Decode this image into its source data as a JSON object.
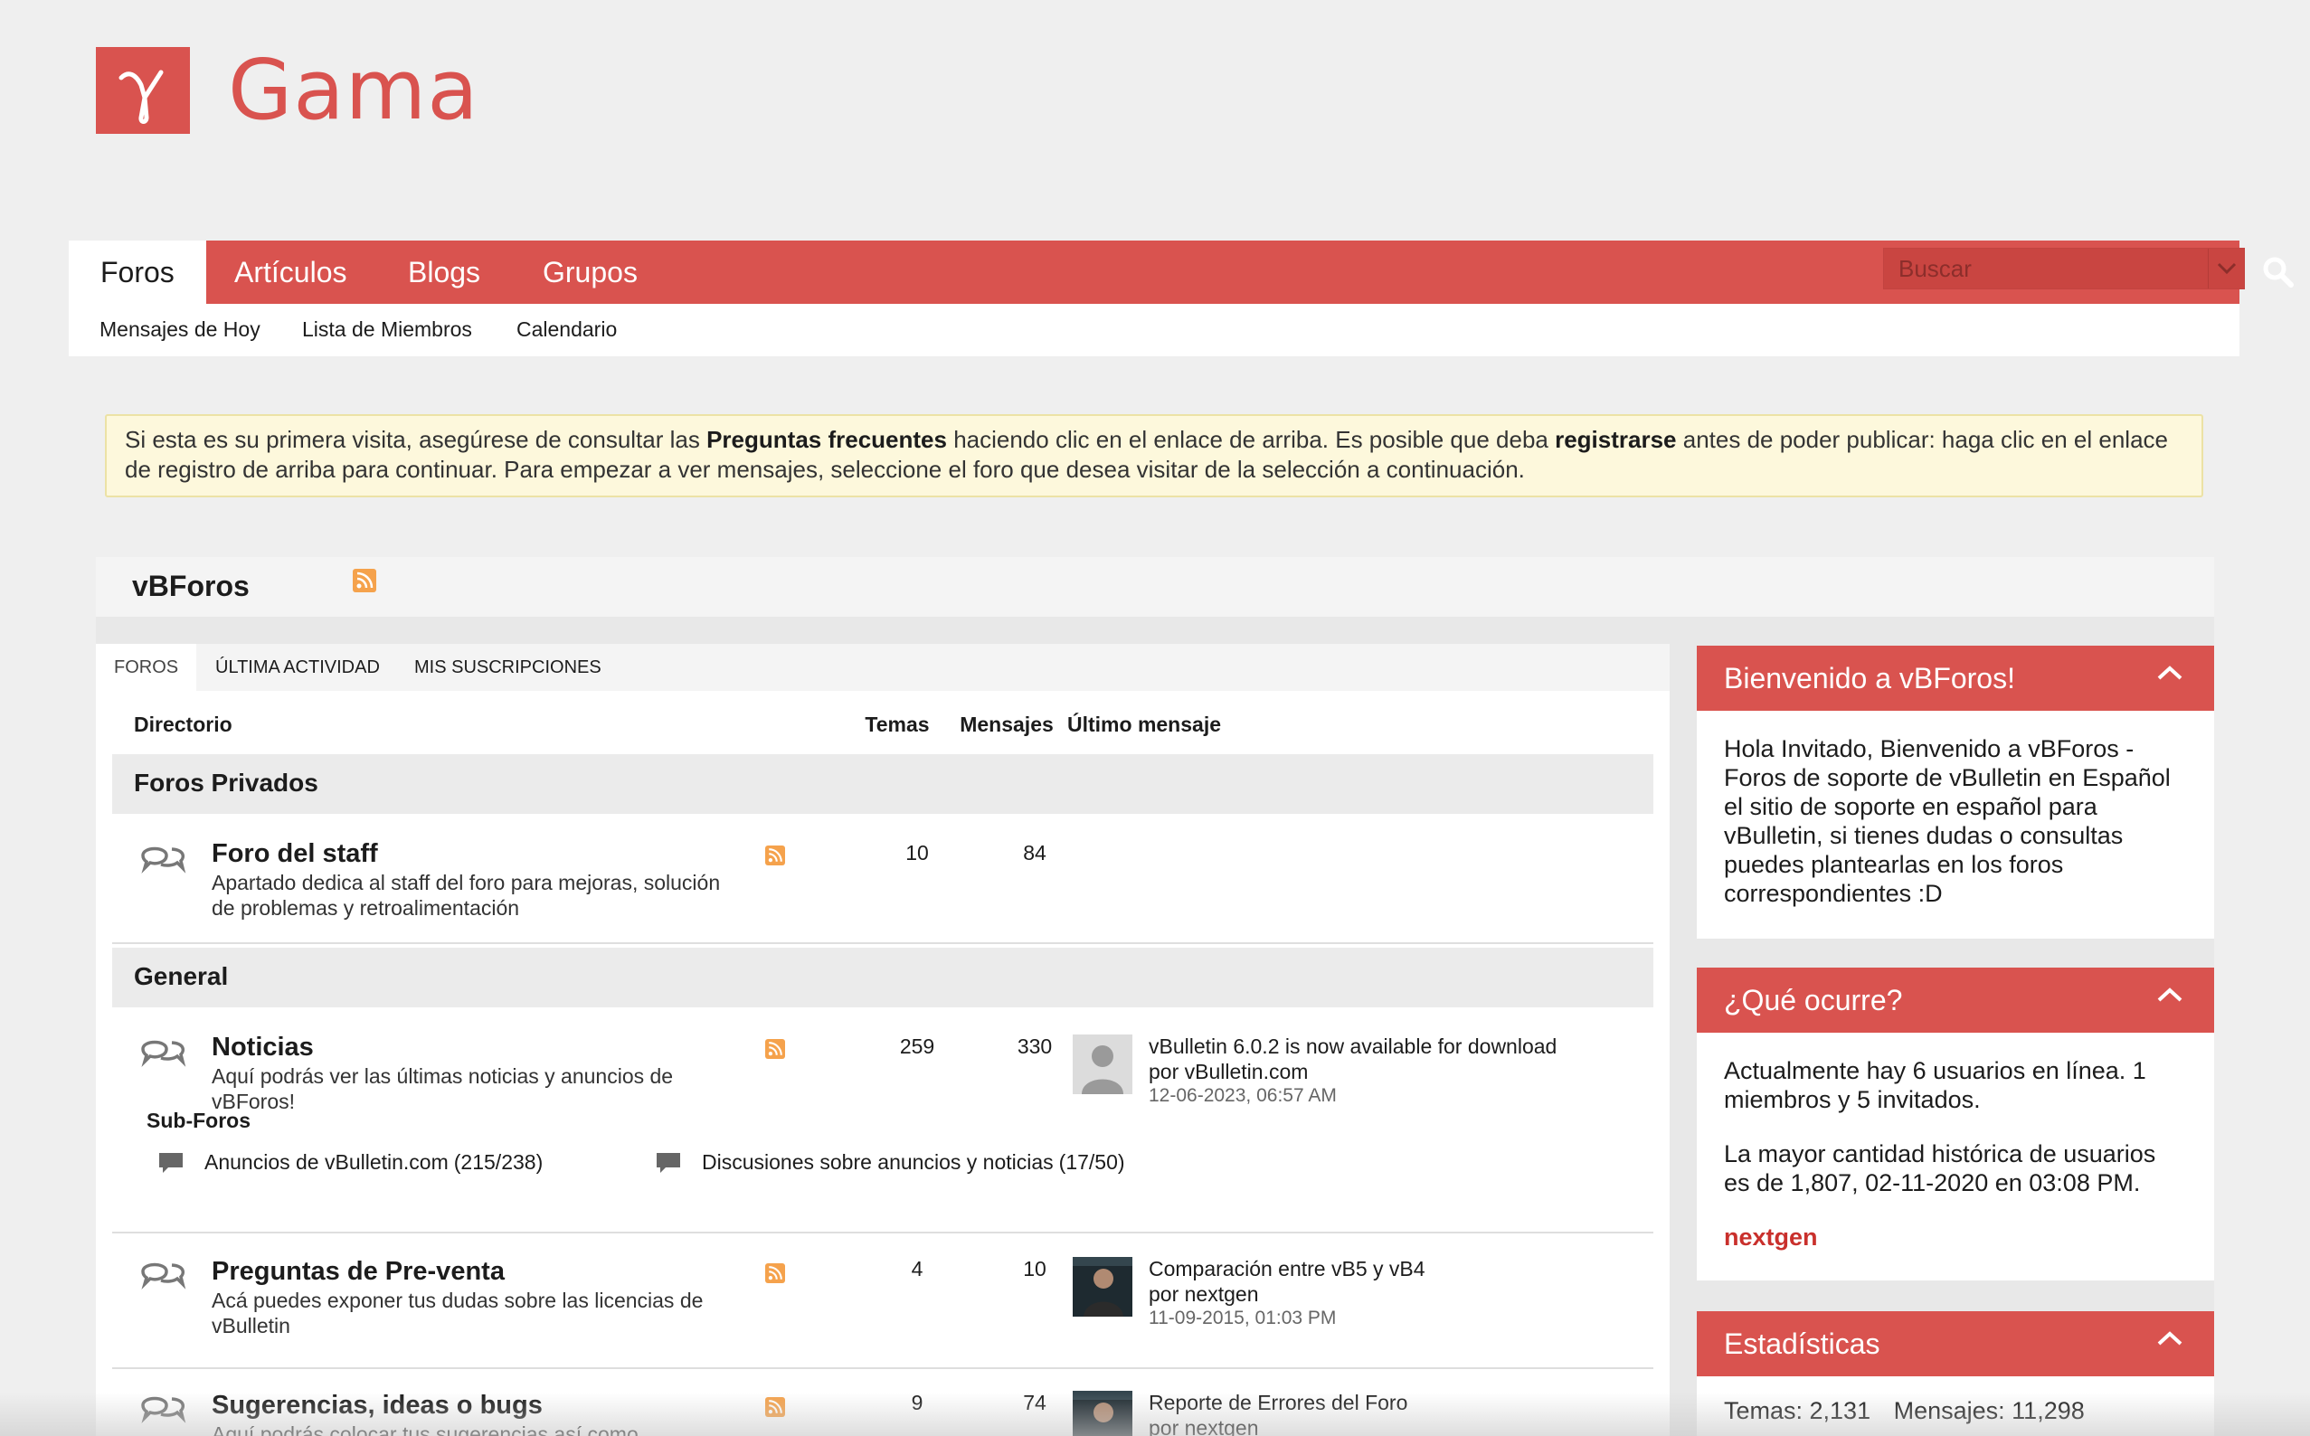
{
  "brand": {
    "name": "Gama",
    "color": "#d9534f"
  },
  "nav": {
    "tabs": [
      {
        "label": "Foros",
        "active": true
      },
      {
        "label": "Artículos"
      },
      {
        "label": "Blogs"
      },
      {
        "label": "Grupos"
      }
    ],
    "search": {
      "placeholder": "Buscar"
    },
    "subnav": [
      "Mensajes de Hoy",
      "Lista de Miembros",
      "Calendario"
    ]
  },
  "notice": {
    "part1": "Si esta es su primera visita, asegúrese de consultar las ",
    "faq": "Preguntas frecuentes",
    "part2": " haciendo clic en el enlace de arriba. Es posible que deba ",
    "register": "registrarse",
    "part3": " antes de poder publicar: haga clic en el enlace de registro de arriba para continuar. Para empezar a ver mensajes, seleccione el foro que desea visitar de la selección a continuación."
  },
  "main": {
    "title": "vBForos",
    "tabs": [
      "FOROS",
      "ÚLTIMA ACTIVIDAD",
      "MIS SUSCRIPCIONES"
    ],
    "columns": {
      "directory": "Directorio",
      "topics": "Temas",
      "posts": "Mensajes",
      "last": "Último mensaje"
    },
    "categories": [
      {
        "name": "Foros Privados",
        "forums": [
          {
            "name": "Foro del staff",
            "desc": "Apartado dedica al staff del foro para mejoras, solución de problemas y retroalimentación",
            "topics": "10",
            "posts": "84"
          }
        ]
      },
      {
        "name": "General",
        "forums": [
          {
            "name": "Noticias",
            "desc": "Aquí podrás ver las últimas noticias y anuncios de vBForos!",
            "topics": "259",
            "posts": "330",
            "last": {
              "title": "vBulletin 6.0.2 is now available for download",
              "by": "por vBulletin.com",
              "date": "12-06-2023, 06:57 AM"
            },
            "subforos_label": "Sub-Foros",
            "subforos": [
              "Anuncios de vBulletin.com",
              "(215/238)",
              "Discusiones sobre anuncios y noticias",
              "(17/50)"
            ]
          },
          {
            "name": "Preguntas de Pre-venta",
            "desc": "Acá puedes exponer tus dudas sobre las licencias de vBulletin",
            "topics": "4",
            "posts": "10",
            "last": {
              "title": "Comparación entre vB5 y vB4",
              "by": "por nextgen",
              "date": "11-09-2015, 01:03 PM"
            }
          },
          {
            "name": "Sugerencias, ideas o bugs",
            "desc": "Aquí podrás colocar tus sugerencias así como",
            "topics": "9",
            "posts": "74",
            "last": {
              "title": "Reporte de Errores del Foro",
              "by": "por nextgen"
            }
          }
        ]
      }
    ]
  },
  "sidebar": {
    "welcome": {
      "title": "Bienvenido a vBForos!",
      "text": "Hola Invitado, Bienvenido a vBForos - Foros de soporte de vBulletin en Español el sitio de soporte en español para vBulletin, si tienes dudas o consultas puedes plantearlas en los foros correspondientes :D"
    },
    "online": {
      "title": "¿Qué ocurre?",
      "line1": "Actualmente hay 6 usuarios en línea. 1 miembros y 5 invitados.",
      "line2": "La mayor cantidad histórica de usuarios es de 1,807, 02-11-2020 en 03:08 PM.",
      "user": "nextgen"
    },
    "stats": {
      "title": "Estadísticas",
      "temas": "Temas: 2,131",
      "mensajes": "Mensajes: 11,298"
    }
  }
}
